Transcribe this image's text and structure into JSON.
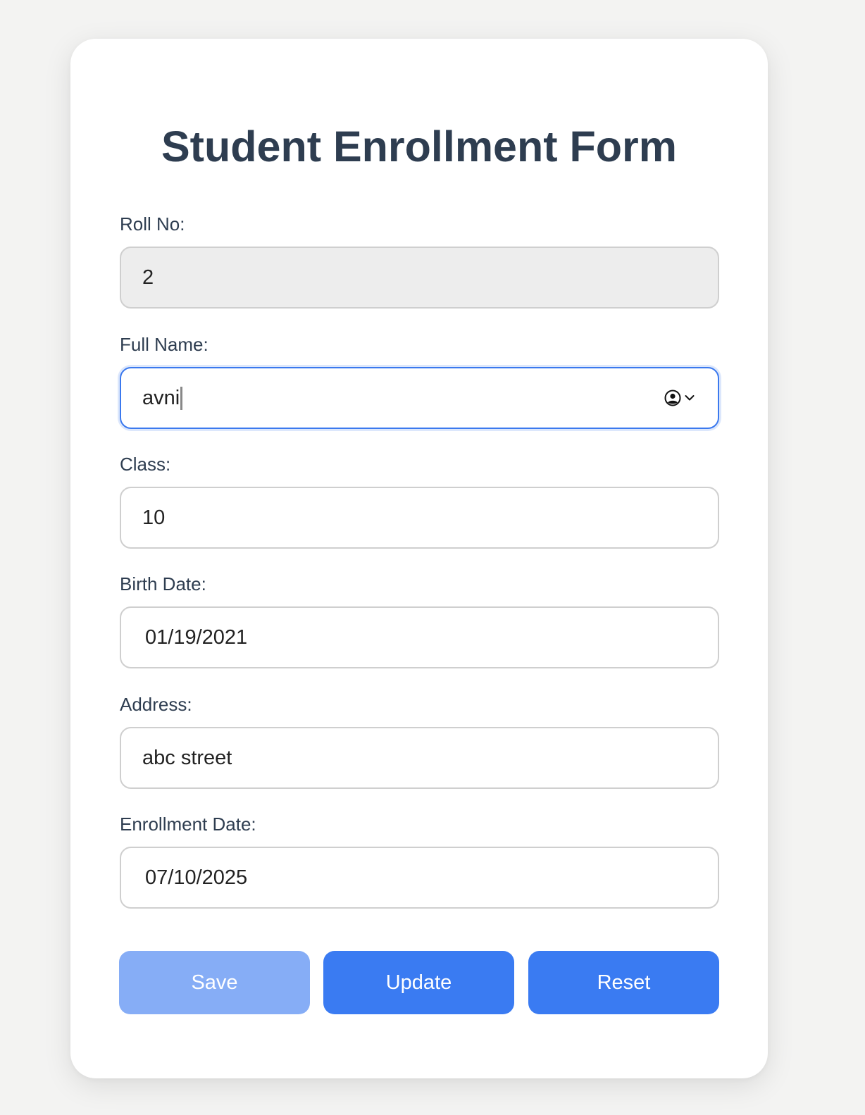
{
  "form": {
    "title": "Student Enrollment Form",
    "fields": {
      "roll_no": {
        "label": "Roll No:",
        "value": "2"
      },
      "full_name": {
        "label": "Full Name:",
        "value": "avni"
      },
      "class": {
        "label": "Class:",
        "value": "10"
      },
      "birth_date": {
        "label": "Birth Date:",
        "value": "01/19/2021"
      },
      "address": {
        "label": "Address:",
        "value": "abc street"
      },
      "enrollment_date": {
        "label": "Enrollment Date:",
        "value": "07/10/2025"
      }
    },
    "buttons": {
      "save": "Save",
      "update": "Update",
      "reset": "Reset"
    }
  },
  "icons": {
    "autofill": "contact-card-icon",
    "dropdown": "chevron-down-icon"
  },
  "colors": {
    "accent": "#3a7bf2",
    "accent_disabled": "#86adf6",
    "title": "#2e3d50",
    "focus_border": "#3b79ee"
  }
}
